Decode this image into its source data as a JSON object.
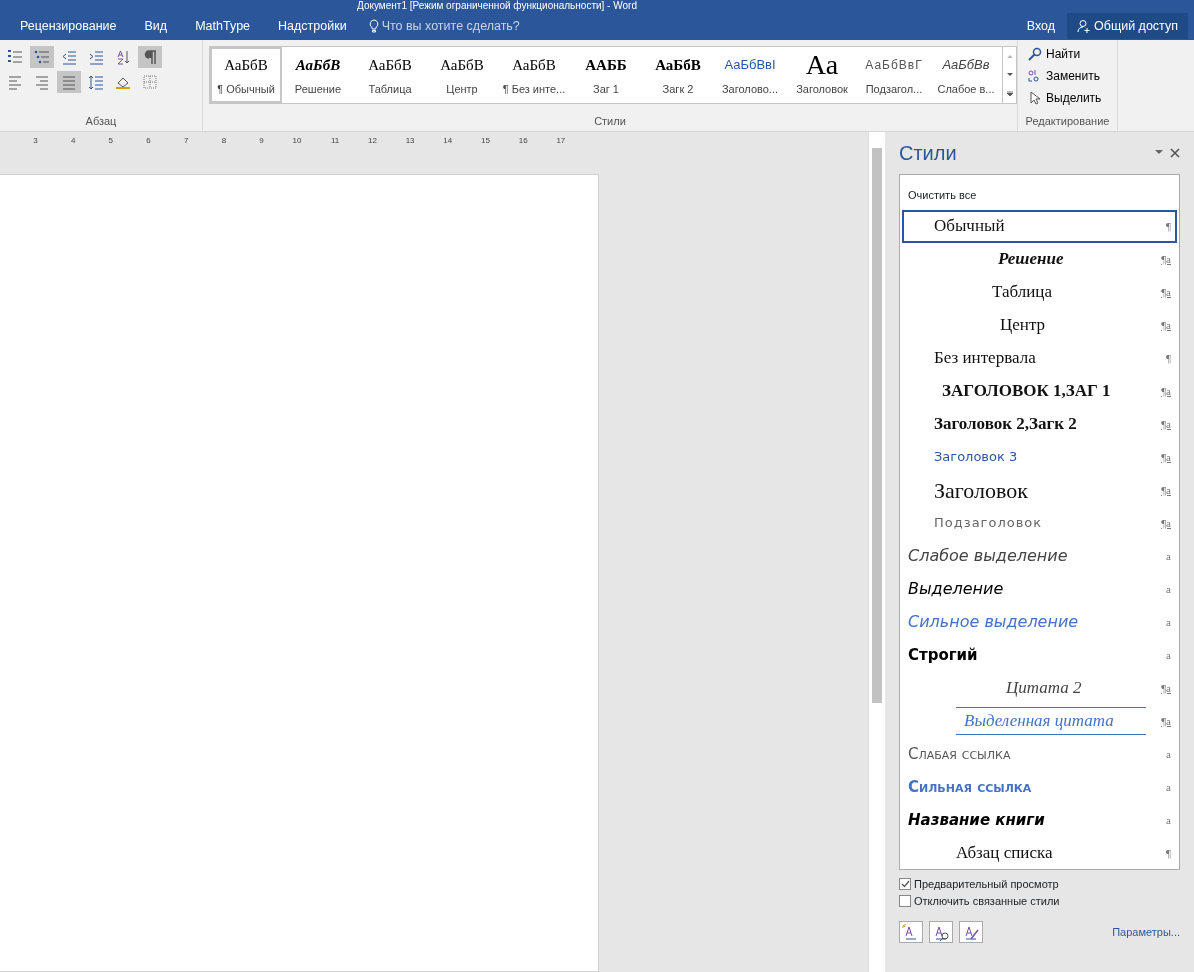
{
  "window": {
    "title": "Документ1 [Режим ограниченной функциональности] - Word"
  },
  "tabs": [
    {
      "label": "Рецензирование",
      "selected": false
    },
    {
      "label": "Вид",
      "selected": false
    },
    {
      "label": "MathType",
      "selected": false
    },
    {
      "label": "Надстройки",
      "selected": false
    }
  ],
  "tell_me": {
    "placeholder": "Что вы хотите сделать?"
  },
  "account": {
    "sign_in": "Вход",
    "share": "Общий доступ"
  },
  "ribbon": {
    "paragraph_group": {
      "label": "Абзац",
      "show_marks_on": true,
      "multilevel_on": true,
      "justify_on": true
    },
    "styles_group": {
      "label": "Стили",
      "items": [
        {
          "preview": "АаБбВ",
          "label": "¶ Обычный",
          "kind": "normal",
          "selected": true
        },
        {
          "preview": "АаБбВ",
          "label": "Решение",
          "kind": "bolditalic",
          "selected": false
        },
        {
          "preview": "АаБбВ",
          "label": "Таблица",
          "kind": "serif",
          "selected": false
        },
        {
          "preview": "АаБбВ",
          "label": "Центр",
          "kind": "serif",
          "selected": false
        },
        {
          "preview": "АаБбВ",
          "label": "¶ Без инте...",
          "kind": "serif",
          "selected": false
        },
        {
          "preview": "ААББ",
          "label": "Заг 1",
          "kind": "boldcaps",
          "selected": false
        },
        {
          "preview": "АаБбВ",
          "label": "Загк 2",
          "kind": "bold",
          "selected": false
        },
        {
          "preview": "АаБбВвI",
          "label": "Заголово...",
          "kind": "blue",
          "selected": false
        },
        {
          "preview": "Аа",
          "label": "Заголовок",
          "kind": "big",
          "selected": false
        },
        {
          "preview": "АаБбВвГ",
          "label": "Подзагол...",
          "kind": "grey",
          "selected": false
        },
        {
          "preview": "АаБбВв",
          "label": "Слабое в...",
          "kind": "italic",
          "selected": false
        }
      ]
    },
    "editing_group": {
      "label": "Редактирование",
      "items": [
        {
          "label": "Найти",
          "kind": "find"
        },
        {
          "label": "Заменить",
          "kind": "replace"
        },
        {
          "label": "Выделить",
          "kind": "select"
        }
      ]
    }
  },
  "ruler": {
    "ticks": [
      "3",
      "4",
      "5",
      "6",
      "7",
      "8",
      "9",
      "10",
      "11",
      "12",
      "13",
      "14",
      "15",
      "16",
      "17"
    ]
  },
  "styles_pane": {
    "title": "Стили",
    "clear_all": "Очистить все",
    "styles": [
      {
        "name": "Обычный",
        "kind": "normal",
        "marker": "¶",
        "selected": true
      },
      {
        "name": "Решение",
        "kind": "solution",
        "marker": "¶a",
        "selected": false
      },
      {
        "name": "Таблица",
        "kind": "table",
        "marker": "¶a",
        "selected": false
      },
      {
        "name": "Центр",
        "kind": "center",
        "marker": "¶a",
        "selected": false
      },
      {
        "name": "Без интервала",
        "kind": "normal",
        "marker": "¶",
        "selected": false
      },
      {
        "name": "ЗАГОЛОВОК 1,ЗАГ 1",
        "kind": "h1",
        "marker": "¶a",
        "selected": false
      },
      {
        "name": "Заголовок 2,Загк 2",
        "kind": "h2",
        "marker": "¶a",
        "selected": false
      },
      {
        "name": "Заголовок 3",
        "kind": "h3",
        "marker": "¶a",
        "selected": false
      },
      {
        "name": "Заголовок",
        "kind": "title",
        "marker": "¶a",
        "selected": false
      },
      {
        "name": "Подзаголовок",
        "kind": "subtitle",
        "marker": "¶a",
        "selected": false
      },
      {
        "name": "Слабое выделение",
        "kind": "subtle",
        "marker": "a",
        "selected": false
      },
      {
        "name": "Выделение",
        "kind": "emphasis",
        "marker": "a",
        "selected": false
      },
      {
        "name": "Сильное выделение",
        "kind": "intense",
        "marker": "a",
        "selected": false
      },
      {
        "name": "Строгий",
        "kind": "strong",
        "marker": "a",
        "selected": false
      },
      {
        "name": "Цитата 2",
        "kind": "quote",
        "marker": "¶a",
        "selected": false
      },
      {
        "name": "Выделенная цитата",
        "kind": "intensequote",
        "marker": "¶a",
        "selected": false
      },
      {
        "name": "Слабая ссылка",
        "kind": "subtleref",
        "marker": "a",
        "selected": false
      },
      {
        "name": "Сильная ссылка",
        "kind": "intenseref",
        "marker": "a",
        "selected": false
      },
      {
        "name": "Название книги",
        "kind": "book",
        "marker": "a",
        "selected": false
      },
      {
        "name": "Абзац списка",
        "kind": "list",
        "marker": "¶",
        "selected": false
      }
    ],
    "options": [
      {
        "label": "Предварительный просмотр",
        "checked": true
      },
      {
        "label": "Отключить связанные стили",
        "checked": false
      }
    ],
    "options_link": "Параметры..."
  }
}
